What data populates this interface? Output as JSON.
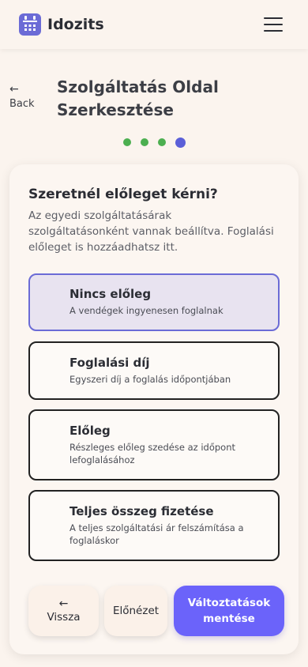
{
  "app": {
    "brand": "Idozits"
  },
  "header": {
    "back_label": "Back",
    "title": "Szolgáltatás Oldal Szerkesztése"
  },
  "steps": {
    "total": 4,
    "current": 4,
    "completed_color": "#4caf50",
    "active_color": "#5b5fd8"
  },
  "question": {
    "title": "Szeretnél előleget kérni?",
    "description": "Az egyedi szolgáltatásárak szolgáltatásonként vannak beállítva. Foglalási előleget is hozzáadhatsz itt."
  },
  "options": [
    {
      "title": "Nincs előleg",
      "subtitle": "A vendégek ingyenesen foglalnak",
      "selected": true
    },
    {
      "title": "Foglalási díj",
      "subtitle": "Egyszeri díj a foglalás időpontjában",
      "selected": false
    },
    {
      "title": "Előleg",
      "subtitle": "Részleges előleg szedése az időpont lefoglalásához",
      "selected": false
    },
    {
      "title": "Teljes összeg fizetése",
      "subtitle": "A teljes szolgáltatási ár felszámítása a foglaláskor",
      "selected": false
    }
  ],
  "actions": {
    "back_label": "Vissza",
    "preview_label": "Előnézet",
    "save_label": "Változtatások mentése"
  },
  "colors": {
    "accent": "#6b63fa",
    "selected_border": "#6b6bd6",
    "background": "#fbf4ee"
  }
}
